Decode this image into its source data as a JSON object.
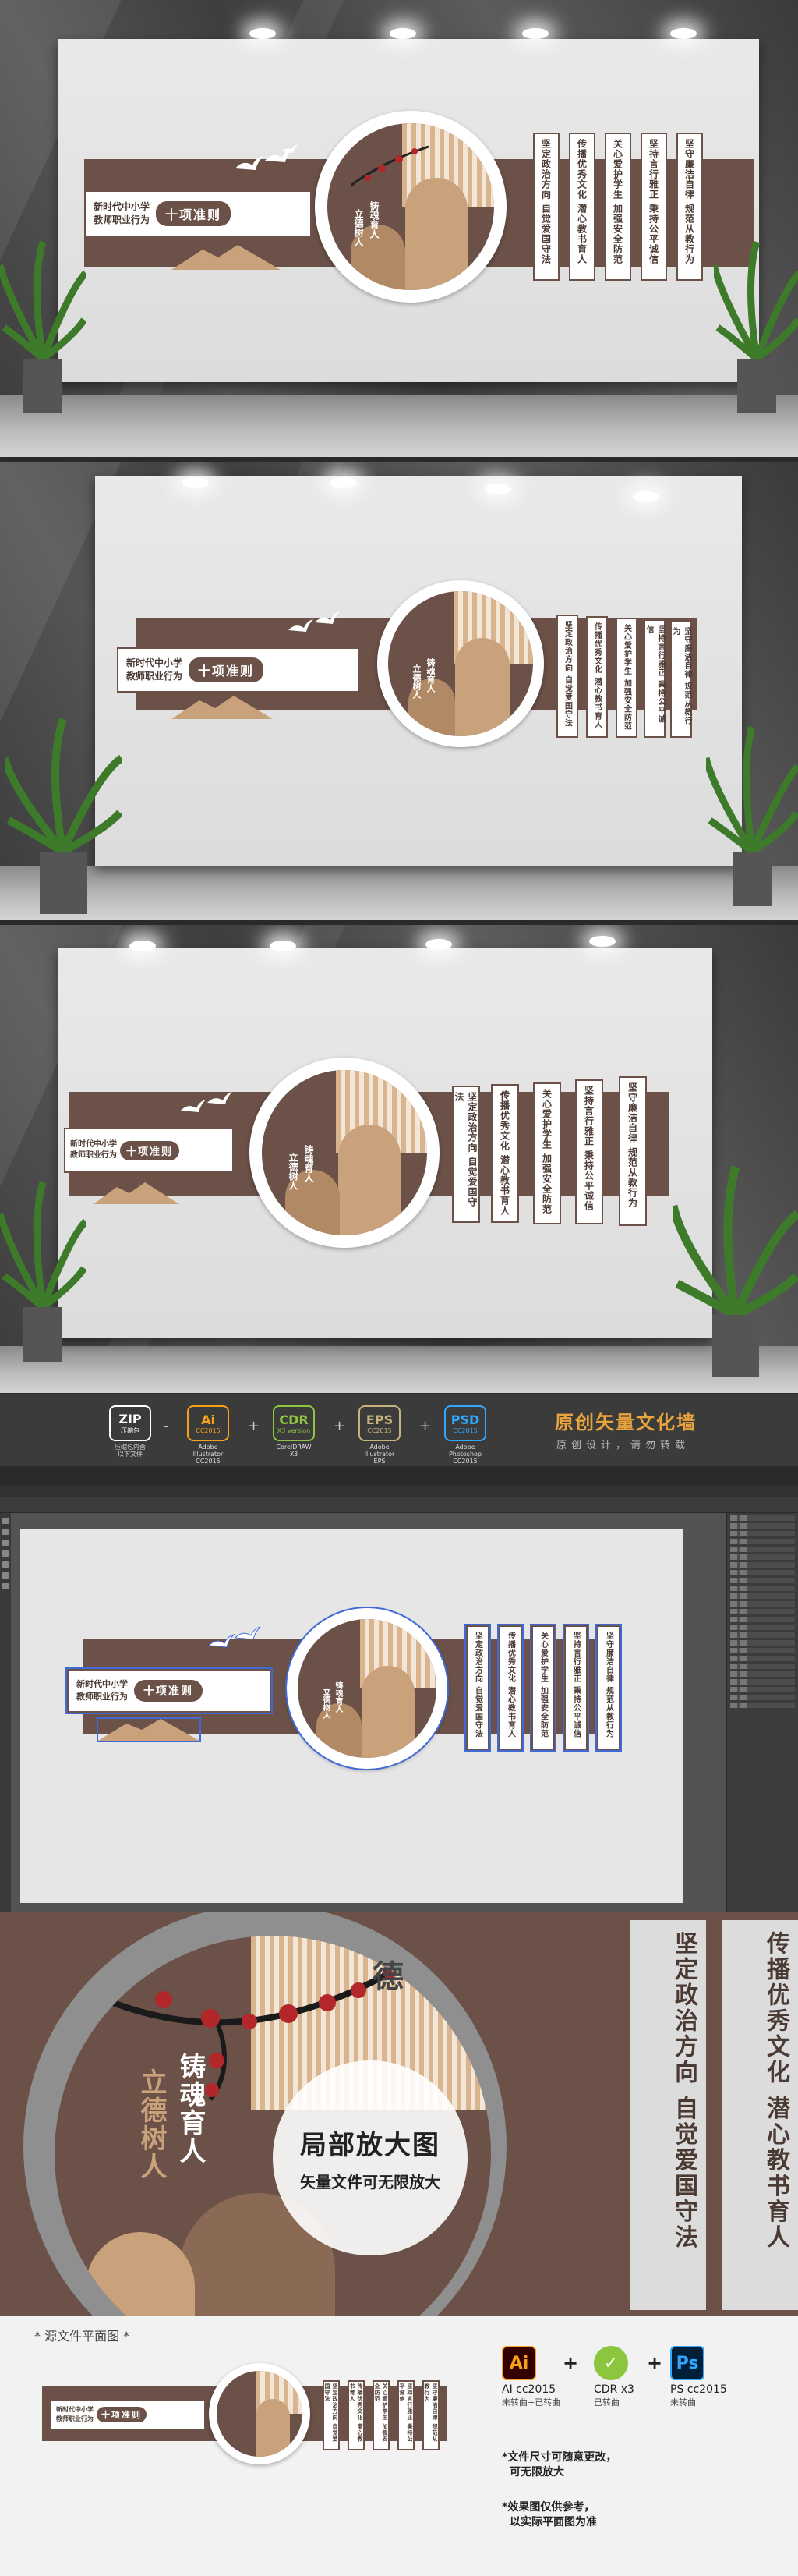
{
  "wall": {
    "subtitle_line1": "新时代中小学",
    "subtitle_line2": "教师职业行为",
    "title": "十项准则",
    "motto_1": "铸魂育人",
    "motto_2": "立德树人",
    "seal": "德",
    "cards": [
      "坚定政治方向 自觉爱国守法",
      "传播优秀文化 潜心教书育人",
      "关心爱护学生 加强安全防范",
      "坚持言行雅正 秉持公平诚信",
      "坚守廉洁自律 规范从教行为"
    ]
  },
  "formats": {
    "zip": {
      "icon": "ZIP",
      "sub": "压缩包",
      "name": "压缩包内含\n以下文件"
    },
    "ai": {
      "icon": "Ai",
      "sub": "CC2015",
      "name": "Adobe Illustrator\nCC2015"
    },
    "cdr": {
      "icon": "CDR",
      "sub": "X3 version",
      "name": "CorelDRAW\nX3"
    },
    "eps": {
      "icon": "EPS",
      "sub": "CC2015",
      "name": "Adobe Illustrator\nEPS"
    },
    "psd": {
      "icon": "PSD",
      "sub": "CC2015",
      "name": "Adobe Photoshop\nCC2015"
    },
    "dash": "-",
    "plus": "+",
    "brand_title": "原创矢量文化墙",
    "brand_sub": "原创设计，请勿转载"
  },
  "detail": {
    "zoom_title": "局部放大图",
    "zoom_sub": "矢量文件可无限放大",
    "card_left": "坚定政治方向 自觉爱国守法",
    "card_right": "传播优秀文化 潜心教书育人"
  },
  "footer": {
    "label": "* 源文件平面图 *",
    "ai_icon": "Ai",
    "ai_name": "AI cc2015",
    "ai_note": "未转曲+已转曲",
    "cdr_name": "CDR x3",
    "cdr_note": "已转曲",
    "ps_icon": "Ps",
    "ps_name": "PS cc2015",
    "ps_note": "未转曲",
    "plus": "+",
    "note1_line1": "*文件尺寸可随意更改，",
    "note1_line2": "可无限放大",
    "note2_line1": "*效果图仅供参考，",
    "note2_line2": "以实际平面图为准"
  },
  "colors": {
    "brown": "#6b5148",
    "tan": "#c9a27c",
    "ai_orange": "#f7a11b",
    "cdr_green": "#8cc63f",
    "eps_tan": "#c7b37c",
    "psd_blue": "#31a8ff",
    "brand_orange": "#e8a33c"
  },
  "icons": [
    "plum-blossom-icon",
    "swallow-icon",
    "mountain-icon",
    "potted-plant-icon"
  ]
}
